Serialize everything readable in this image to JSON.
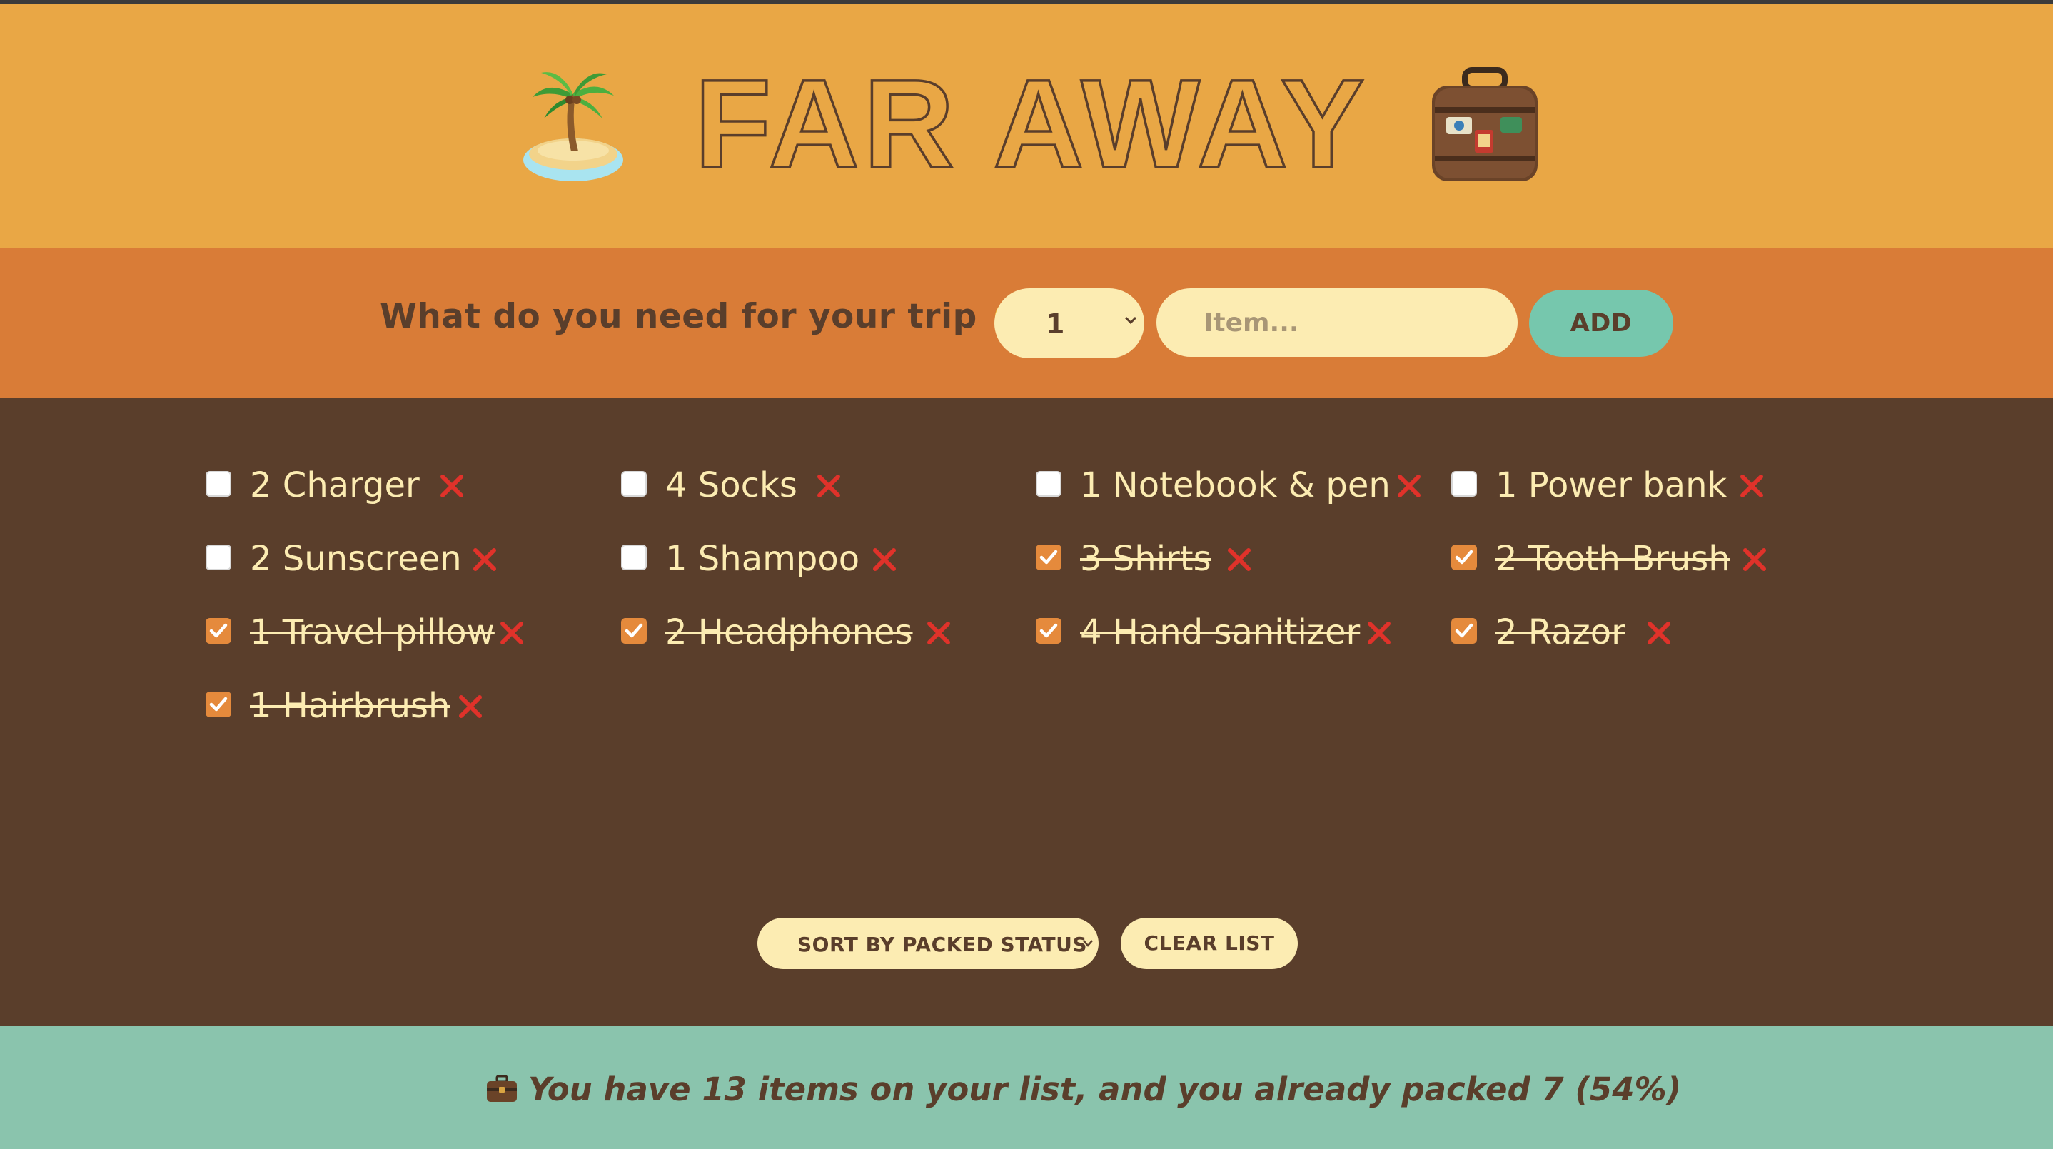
{
  "app": {
    "title": "FAR AWAY"
  },
  "colors": {
    "header_bg": "#e9a745",
    "form_bg": "#d97c37",
    "list_bg": "#5a3e2b",
    "footer_bg": "#8ac4ad",
    "accent_green": "#76c7ad",
    "cream": "#fcecb2",
    "delete_red": "#e0322a"
  },
  "icons": {
    "left_logo": "palm-island-icon",
    "right_logo": "suitcase-icon",
    "prompt_emoji": "heart-eyes-emoji-icon",
    "footer_emoji": "briefcase-icon",
    "delete": "cross-mark-icon"
  },
  "form": {
    "prompt": "What do you need for your trip",
    "prompt_suffix": "?",
    "quantity_value": "1",
    "item_placeholder": "Item...",
    "add_label": "ADD"
  },
  "items": [
    {
      "quantity": 2,
      "description": "Charger",
      "packed": false
    },
    {
      "quantity": 4,
      "description": "Socks",
      "packed": false
    },
    {
      "quantity": 1,
      "description": "Notebook & pen",
      "packed": false
    },
    {
      "quantity": 1,
      "description": "Power bank",
      "packed": false
    },
    {
      "quantity": 2,
      "description": "Sunscreen",
      "packed": false
    },
    {
      "quantity": 1,
      "description": "Shampoo",
      "packed": false
    },
    {
      "quantity": 3,
      "description": "Shirts",
      "packed": true
    },
    {
      "quantity": 2,
      "description": "Tooth Brush",
      "packed": true
    },
    {
      "quantity": 1,
      "description": "Travel pillow",
      "packed": true
    },
    {
      "quantity": 2,
      "description": "Headphones",
      "packed": true
    },
    {
      "quantity": 4,
      "description": "Hand sanitizer",
      "packed": true
    },
    {
      "quantity": 2,
      "description": "Razor",
      "packed": true
    },
    {
      "quantity": 1,
      "description": "Hairbrush",
      "packed": true
    }
  ],
  "actions": {
    "sort_value": "SORT BY PACKED STATUS",
    "clear_label": "CLEAR LIST"
  },
  "stats": {
    "text": "You have 13 items on your list, and you already packed 7 (54%)"
  }
}
